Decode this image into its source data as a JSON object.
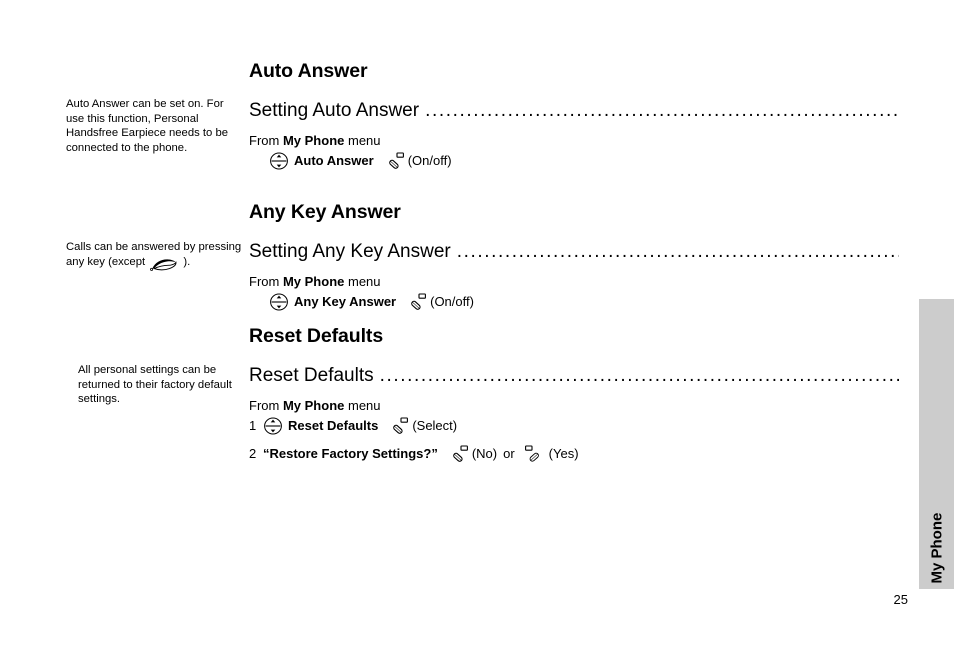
{
  "page": {
    "number": "25",
    "thumb_tab_label": "My Phone",
    "background_color": "#ffffff",
    "tab_color": "#cccccc"
  },
  "margin_notes": [
    {
      "id": "auto-answer-note",
      "text": "Auto Answer can be set on. For use this function, Personal Handsfree Earpiece needs to be connected to the phone."
    },
    {
      "id": "any-key-answer-note",
      "text_before": "Calls can be answered by pressing any key (except",
      "icon": "end-call-handset-icon",
      "text_after": ")."
    },
    {
      "id": "reset-defaults-note",
      "text": "All personal settings can be returned to their factory default settings."
    }
  ],
  "sections": [
    {
      "id": "auto-answer",
      "heading": "Auto Answer",
      "sub_heading": "Setting Auto Answer",
      "leader": "..........................................................................................",
      "from_prefix": "From",
      "from_menu": "My Phone",
      "from_suffix": "menu",
      "steps": [
        {
          "number": "",
          "nav_icon": "navigation-key-icon",
          "label": "Auto Answer",
          "soft_icon": "left-softkey-icon",
          "action": "(On/off)"
        }
      ]
    },
    {
      "id": "any-key-answer",
      "heading": "Any Key Answer",
      "sub_heading": "Setting Any Key Answer",
      "leader": "..........................................................................................",
      "from_prefix": "From",
      "from_menu": "My Phone",
      "from_suffix": "menu",
      "steps": [
        {
          "number": "",
          "nav_icon": "navigation-key-icon",
          "label": "Any Key Answer",
          "soft_icon": "left-softkey-icon",
          "action": "(On/off)"
        }
      ]
    },
    {
      "id": "reset-defaults",
      "heading": "Reset Defaults",
      "sub_heading": "Reset Defaults",
      "leader": "..........................................................................................",
      "from_prefix": "From",
      "from_menu": "My Phone",
      "from_suffix": "menu",
      "steps": [
        {
          "number": "1",
          "nav_icon": "navigation-key-icon",
          "label": "Reset Defaults",
          "soft_icon": "left-softkey-icon",
          "action": "(Select)"
        },
        {
          "number": "2",
          "label": "“Restore Factory Settings?”",
          "soft_icon": "left-softkey-icon",
          "action": "(No)",
          "conjunction": "or",
          "soft_icon_2": "right-softkey-icon",
          "action_2": "(Yes)"
        }
      ]
    }
  ]
}
